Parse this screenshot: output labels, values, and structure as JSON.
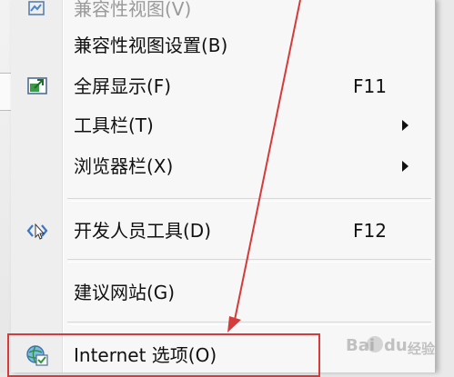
{
  "menu": {
    "items": [
      {
        "label": "兼容性视图(V)",
        "icon": "compat-view-icon",
        "disabled": true
      },
      {
        "label": "兼容性视图设置(B)"
      },
      {
        "label": "全屏显示(F)",
        "shortcut": "F11",
        "icon": "fullscreen-icon"
      },
      {
        "label": "工具栏(T)",
        "submenu": true
      },
      {
        "label": "浏览器栏(X)",
        "submenu": true
      },
      {
        "label": "开发人员工具(D)",
        "shortcut": "F12",
        "icon": "developer-tools-icon"
      },
      {
        "label": "建议网站(G)"
      },
      {
        "label": "Internet 选项(O)",
        "icon": "internet-options-icon",
        "highlighted": true
      }
    ]
  },
  "annotation": {
    "color": "#d63a3a"
  },
  "watermark": {
    "part1": "Bai",
    "part2": "du",
    "part3": "经验"
  }
}
